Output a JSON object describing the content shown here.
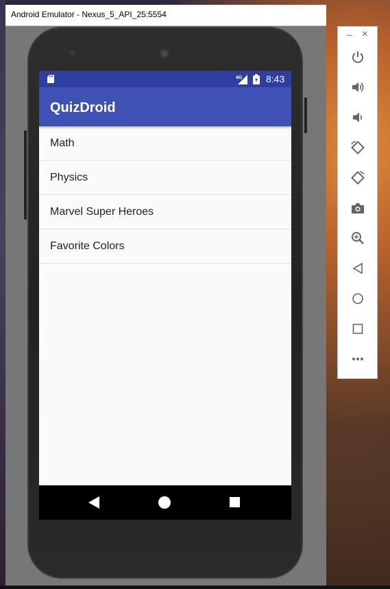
{
  "window": {
    "title": "Android Emulator - Nexus_5_API_25:5554"
  },
  "status_bar": {
    "time": "8:43",
    "network": "4G",
    "color": "#303f9f"
  },
  "app_bar": {
    "title": "QuizDroid",
    "color": "#3f51b5"
  },
  "quiz_list": {
    "items": [
      {
        "label": "Math"
      },
      {
        "label": "Physics"
      },
      {
        "label": "Marvel Super Heroes"
      },
      {
        "label": "Favorite Colors"
      }
    ]
  },
  "nav_bar": {
    "buttons": [
      "back-icon",
      "home-icon",
      "recents-icon"
    ]
  },
  "toolbar": {
    "window_controls": {
      "minimize": "–",
      "close": "×"
    },
    "buttons": [
      "power-icon",
      "volume-up-icon",
      "volume-down-icon",
      "rotate-left-icon",
      "rotate-right-icon",
      "camera-icon",
      "zoom-icon",
      "back-icon",
      "home-icon",
      "overview-icon",
      "more-icon"
    ]
  }
}
